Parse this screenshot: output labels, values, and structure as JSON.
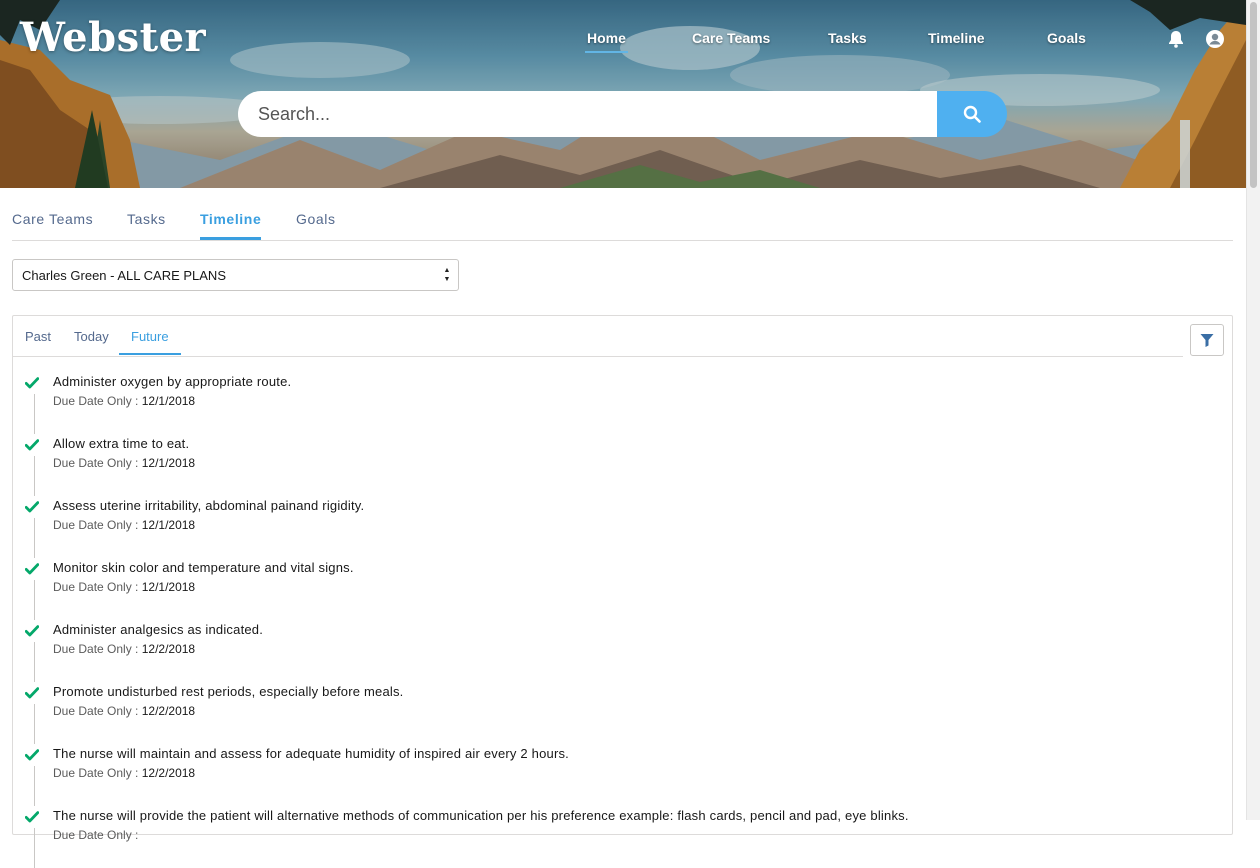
{
  "brand": {
    "logo": "Webster"
  },
  "topnav": {
    "items": [
      {
        "label": "Home",
        "active": true
      },
      {
        "label": "Care Teams",
        "active": false
      },
      {
        "label": "Tasks",
        "active": false
      },
      {
        "label": "Timeline",
        "active": false
      },
      {
        "label": "Goals",
        "active": false
      }
    ],
    "icons": [
      "bell-icon",
      "user-avatar-icon"
    ]
  },
  "search": {
    "placeholder": "Search...",
    "button_icon": "search-icon"
  },
  "main_tabs": [
    {
      "label": "Care Teams",
      "active": false
    },
    {
      "label": "Tasks",
      "active": false
    },
    {
      "label": "Timeline",
      "active": true
    },
    {
      "label": "Goals",
      "active": false
    }
  ],
  "care_plan_select": {
    "value": "Charles Green - ALL CARE PLANS"
  },
  "timeline": {
    "sub_tabs": [
      {
        "label": "Past",
        "active": false
      },
      {
        "label": "Today",
        "active": false
      },
      {
        "label": "Future",
        "active": true
      }
    ],
    "filter_icon": "filter-icon",
    "items": [
      {
        "title": "Administer oxygen by appropriate route.",
        "meta_label": "Due Date Only :",
        "date": "12/1/2018"
      },
      {
        "title": "Allow extra time to eat.",
        "meta_label": "Due Date Only :",
        "date": "12/1/2018"
      },
      {
        "title": "Assess uterine irritability, abdominal painand rigidity.",
        "meta_label": "Due Date Only :",
        "date": "12/1/2018"
      },
      {
        "title": "Monitor skin color and temperature and vital signs.",
        "meta_label": "Due Date Only :",
        "date": "12/1/2018"
      },
      {
        "title": "Administer analgesics as indicated.",
        "meta_label": "Due Date Only :",
        "date": "12/2/2018"
      },
      {
        "title": "Promote undisturbed rest periods, especially before meals.",
        "meta_label": "Due Date Only :",
        "date": "12/2/2018"
      },
      {
        "title": "The nurse will maintain and assess for adequate humidity of inspired air every 2 hours.",
        "meta_label": "Due Date Only :",
        "date": "12/2/2018"
      },
      {
        "title": "The nurse will provide the patient will alternative methods of communication per his preference example: flash cards, pencil and pad, eye blinks.",
        "meta_label": "Due Date Only :",
        "date": ""
      }
    ]
  },
  "colors": {
    "accent": "#3a9fe0",
    "check": "#04a86a",
    "search_button": "#4fb0f0"
  }
}
